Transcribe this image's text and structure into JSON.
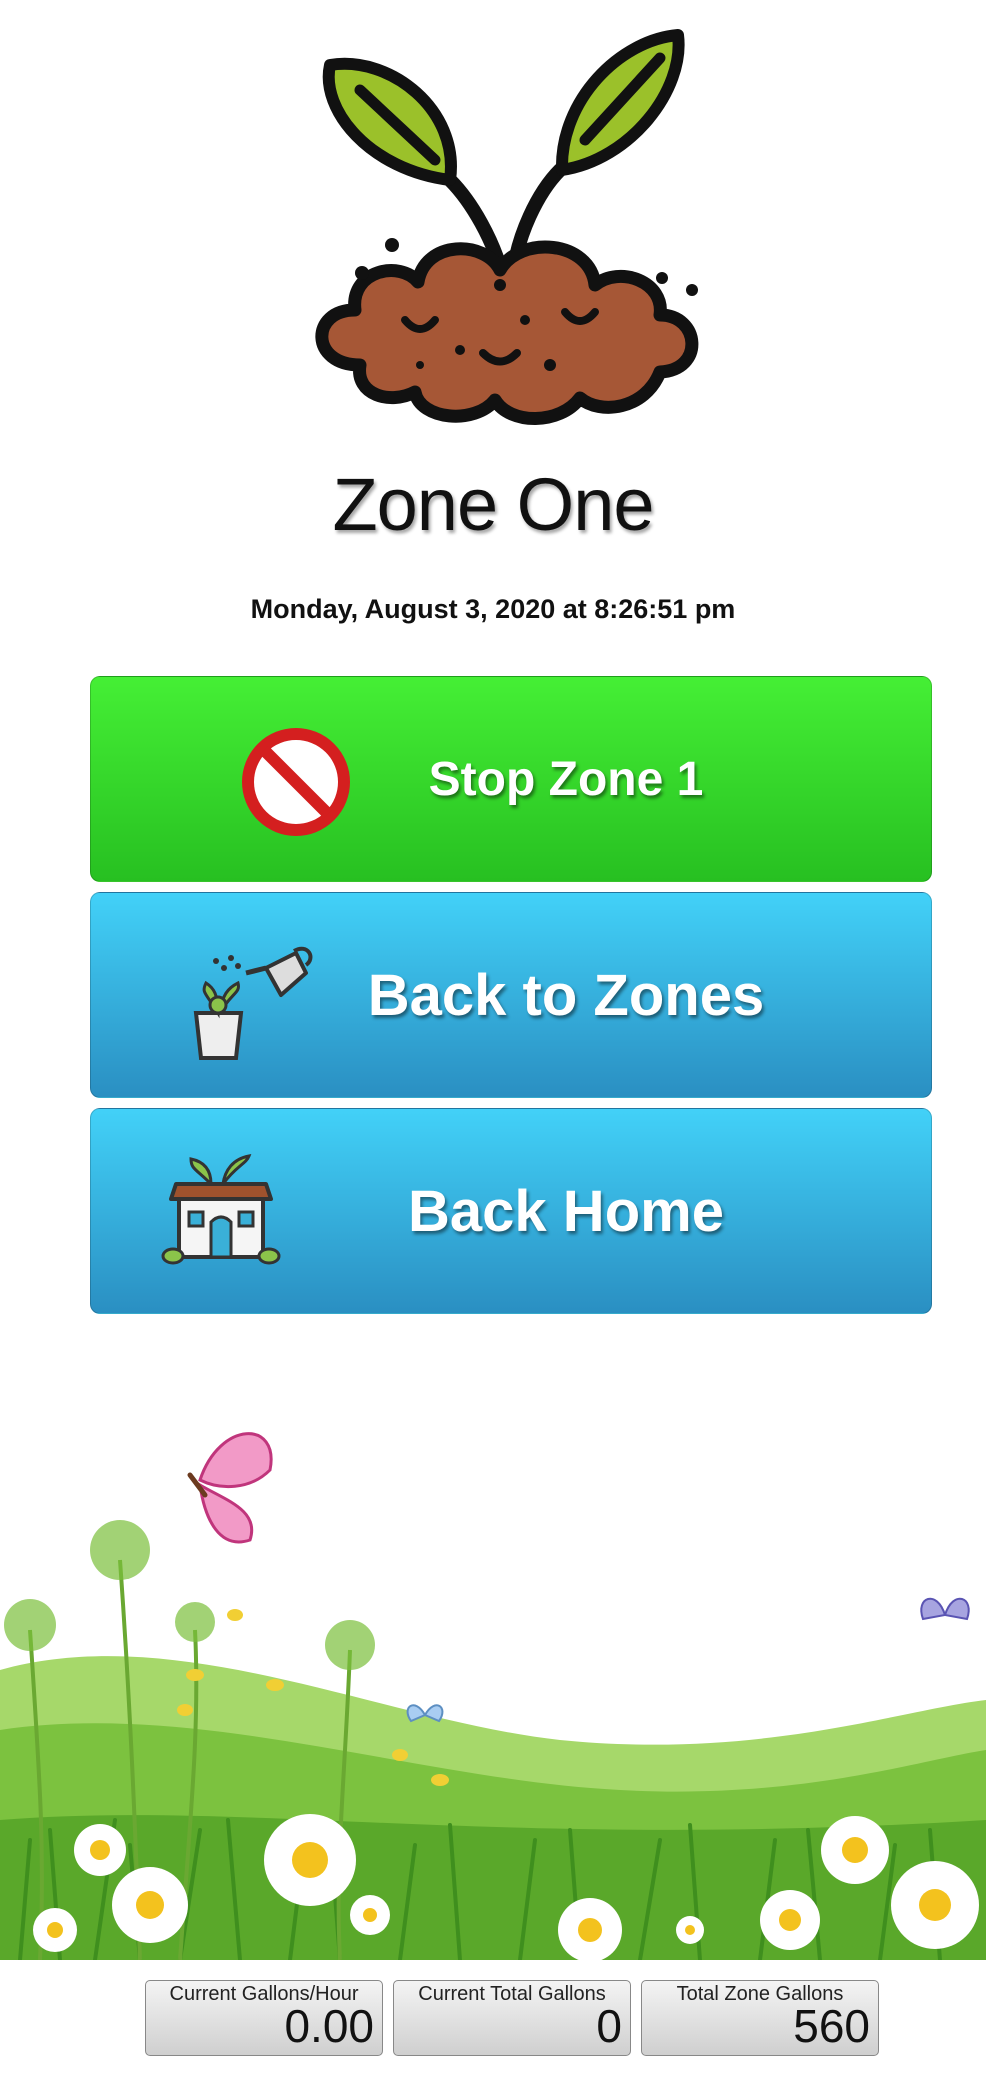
{
  "zone_title": "Zone One",
  "datetime": "Monday, August 3, 2020 at 8:26:51 pm",
  "buttons": {
    "stop": {
      "label": "Stop Zone 1",
      "icon": "no-entry-icon"
    },
    "zones": {
      "label": "Back to Zones",
      "icon": "watering-can-icon"
    },
    "home": {
      "label": "Back Home",
      "icon": "house-icon"
    }
  },
  "meters": [
    {
      "label": "Current Gallons/Hour",
      "value": "0.00"
    },
    {
      "label": "Current Total Gallons",
      "value": "0"
    },
    {
      "label": "Total Zone Gallons",
      "value": "560"
    }
  ],
  "colors": {
    "stop_button": "#34d52a",
    "nav_button": "#36b1dd",
    "soil": "#a0522d",
    "leaf": "#9bc12a"
  }
}
